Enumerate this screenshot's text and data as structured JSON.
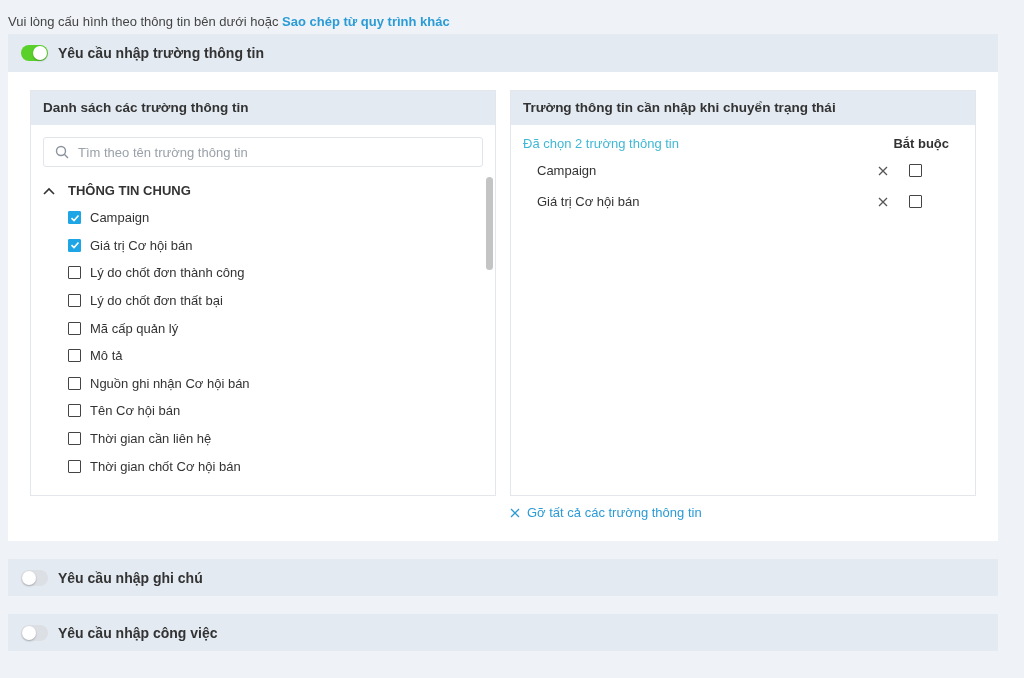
{
  "intro": {
    "text": "Vui lòng cấu hình theo thông tin bên dưới hoặc",
    "link": "Sao chép từ quy trình khác"
  },
  "sections": [
    {
      "title": "Yêu cầu nhập trường thông tin",
      "on": true,
      "expanded": true,
      "fields_panel": {
        "title": "Danh sách các trường thông tin",
        "search": {
          "placeholder": "Tìm theo tên trường thông tin"
        },
        "groups": [
          {
            "title": "THÔNG TIN CHUNG",
            "expanded": true,
            "items": [
              {
                "label": "Campaign",
                "checked": true
              },
              {
                "label": "Giá trị Cơ hội bán",
                "checked": true
              },
              {
                "label": "Lý do chốt đơn thành công",
                "checked": false
              },
              {
                "label": "Lý do chốt đơn thất bại",
                "checked": false
              },
              {
                "label": "Mã cấp quản lý",
                "checked": false
              },
              {
                "label": "Mô tả",
                "checked": false
              },
              {
                "label": "Nguồn ghi nhận Cơ hội bán",
                "checked": false
              },
              {
                "label": "Tên Cơ hội bán",
                "checked": false
              },
              {
                "label": "Thời gian cần liên hệ",
                "checked": false
              },
              {
                "label": "Thời gian chốt Cơ hội bán",
                "checked": false
              }
            ]
          }
        ]
      },
      "selected_panel": {
        "title": "Trường thông tin cần nhập khi chuyển trạng thái",
        "count_text": "Đã chọn 2 trường thông tin",
        "required_header": "Bắt buộc",
        "rows": [
          {
            "label": "Campaign",
            "required": false
          },
          {
            "label": "Giá trị Cơ hội bán",
            "required": false
          }
        ]
      },
      "clear_all": "Gỡ tất cả các trường thông tin"
    },
    {
      "title": "Yêu cầu nhập ghi chú",
      "on": false,
      "expanded": false
    },
    {
      "title": "Yêu cầu nhập công việc",
      "on": false,
      "expanded": false
    }
  ]
}
